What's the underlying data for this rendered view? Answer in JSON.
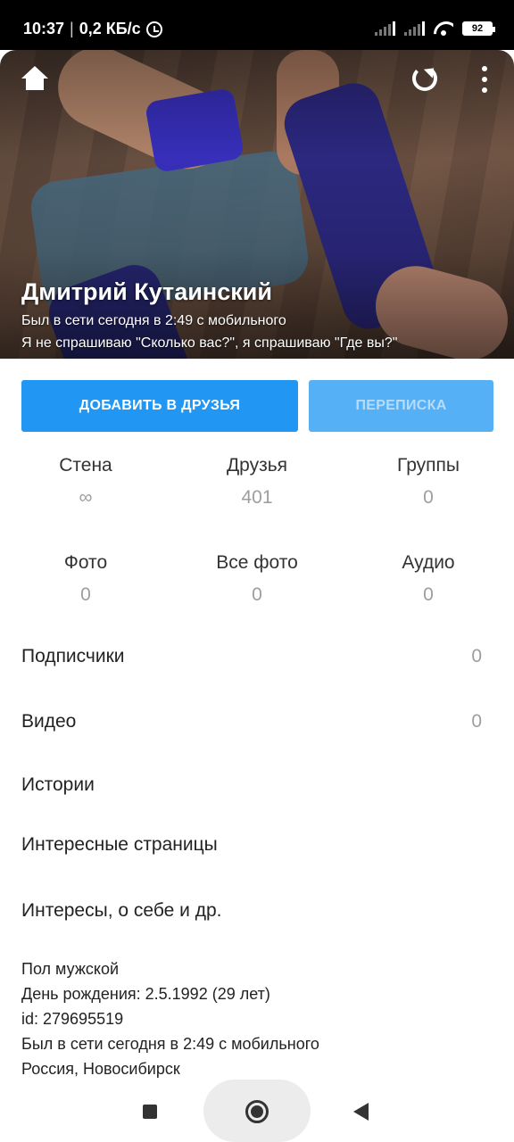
{
  "status_bar": {
    "time": "10:37",
    "separator": "|",
    "net_speed": "0,2 КБ/с",
    "battery": "92"
  },
  "header": {
    "name": "Дмитрий Кутаинский",
    "online": "Был в сети сегодня в 2:49 с мобильного",
    "status": "Я не спрашиваю \"Сколько вас?\", я спрашиваю \"Где вы?\""
  },
  "actions": {
    "add_friend": "ДОБАВИТЬ В ДРУЗЬЯ",
    "message": "ПЕРЕПИСКА"
  },
  "stats": [
    {
      "label": "Стена",
      "count": "∞"
    },
    {
      "label": "Друзья",
      "count": "401"
    },
    {
      "label": "Группы",
      "count": "0"
    },
    {
      "label": "Фото",
      "count": "0"
    },
    {
      "label": "Все фото",
      "count": "0"
    },
    {
      "label": "Аудио",
      "count": "0"
    }
  ],
  "menu": [
    {
      "label": "Подписчики",
      "count": "0"
    },
    {
      "label": "Видео",
      "count": "0"
    },
    {
      "label": "Истории",
      "count": ""
    },
    {
      "label": "Интересные страницы",
      "count": ""
    },
    {
      "label": "Интересы, о себе и др.",
      "count": ""
    }
  ],
  "info": {
    "gender": "Пол мужской",
    "birthday": "День рождения: 2.5.1992 (29 лет)",
    "id": "id: 279695519",
    "last_seen": "Был в сети сегодня в 2:49 с мобильного",
    "location": "Россия, Новосибирск"
  },
  "colors": {
    "accent": "#2196f3",
    "accent_disabled": "#56b0f5",
    "muted_text": "#9e9e9e"
  },
  "icons": [
    "home-icon",
    "refresh-icon",
    "more-icon",
    "alarm-icon",
    "signal-icon",
    "wifi-icon",
    "battery-icon",
    "nav-recents-icon",
    "nav-home-icon",
    "nav-back-icon"
  ]
}
